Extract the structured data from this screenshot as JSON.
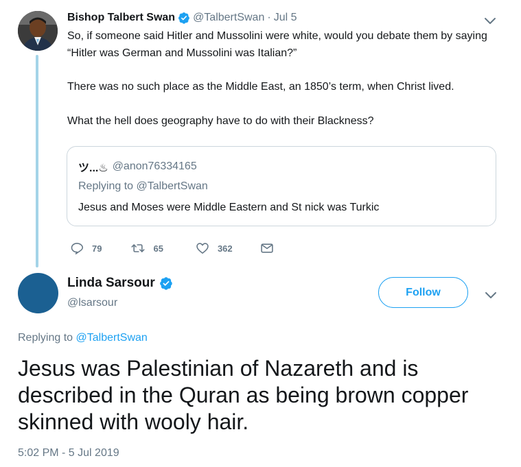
{
  "parent_tweet": {
    "name": "Bishop Talbert Swan",
    "handle": "@TalbertSwan",
    "separator": "·",
    "date": "Jul 5",
    "paragraphs": [
      "So, if someone said Hitler and Mussolini were white, would you debate them by saying “Hitler was German and Mussolini was Italian?”",
      "There was no such place as the Middle East, an 1850’s term, when Christ lived.",
      "What the hell does geography have to do with their Blackness?"
    ],
    "quote": {
      "name": "ツ...♨",
      "handle": "@anon76334165",
      "replying_prefix": "Replying to",
      "replying_to": "@TalbertSwan",
      "text": "Jesus and Moses were Middle Eastern and St nick was Turkic"
    },
    "actions": {
      "replies": "79",
      "retweets": "65",
      "likes": "362"
    }
  },
  "main_tweet": {
    "name": "Linda Sarsour",
    "handle": "@lsarsour",
    "follow_label": "Follow",
    "replying_prefix": "Replying to",
    "replying_to": "@TalbertSwan",
    "text": "Jesus was Palestinian of Nazareth and is described in the Quran as being brown copper skinned with wooly hair.",
    "timestamp": "5:02 PM - 5 Jul 2019"
  },
  "colors": {
    "accent": "#1da1f2",
    "muted": "#657786",
    "text": "#14171a",
    "thread_line": "#a4d4e8",
    "avatar_main": "#1b6092"
  },
  "icons": [
    "verified-badge-icon",
    "chevron-down-icon",
    "reply-icon",
    "retweet-icon",
    "like-icon",
    "direct-message-icon"
  ]
}
